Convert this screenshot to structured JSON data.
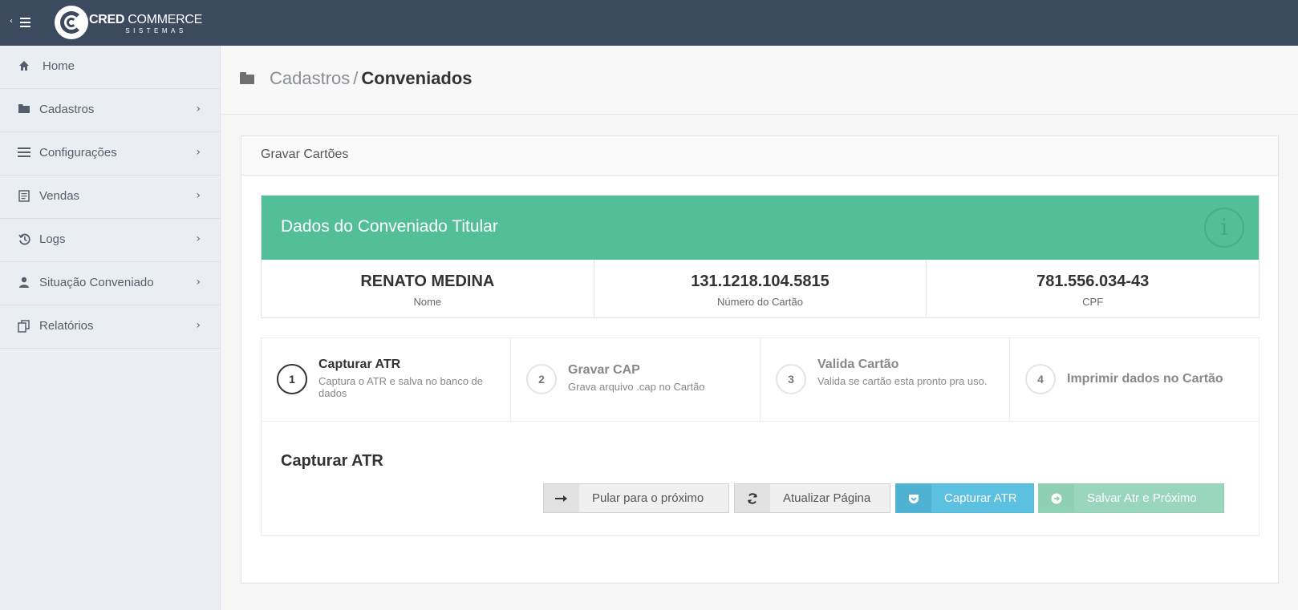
{
  "app": {
    "logo_brand_bold": "CRED",
    "logo_brand_rest": " COMMERCE",
    "logo_sub": "SISTEMAS"
  },
  "sidebar": {
    "items": [
      {
        "label": "Home",
        "icon": "home-icon"
      },
      {
        "label": "Cadastros",
        "icon": "folder-icon"
      },
      {
        "label": "Configurações",
        "icon": "list-icon"
      },
      {
        "label": "Vendas",
        "icon": "document-icon"
      },
      {
        "label": "Logs",
        "icon": "history-icon"
      },
      {
        "label": "Situação Conveniado",
        "icon": "user-icon"
      },
      {
        "label": "Relatórios",
        "icon": "copy-icon"
      }
    ]
  },
  "breadcrumb": {
    "parent": "Cadastros",
    "separator": "/",
    "current": "Conveniados"
  },
  "panel": {
    "title": "Gravar Cartões"
  },
  "info": {
    "title": "Dados do Conveniado Titular",
    "accent_color": "#52bf98",
    "fields": [
      {
        "value": "RENATO MEDINA",
        "label": "Nome"
      },
      {
        "value": "131.1218.104.5815",
        "label": "Número do Cartão"
      },
      {
        "value": "781.556.034-43",
        "label": "CPF"
      }
    ]
  },
  "wizard": {
    "steps": [
      {
        "num": "1",
        "title": "Capturar ATR",
        "desc": "Captura o ATR e salva no banco de dados",
        "active": true
      },
      {
        "num": "2",
        "title": "Gravar CAP",
        "desc": "Grava arquivo .cap no Cartão",
        "active": false
      },
      {
        "num": "3",
        "title": "Valida Cartão",
        "desc": "Valida se cartão esta pronto pra uso.",
        "active": false
      },
      {
        "num": "4",
        "title": "Imprimir dados no Cartão",
        "desc": "",
        "active": false
      }
    ],
    "current_title": "Capturar ATR",
    "buttons": {
      "skip": "Pular para o próximo",
      "refresh": "Atualizar Página",
      "capture": "Capturar ATR",
      "save": "Salvar Atr e Próximo"
    }
  }
}
